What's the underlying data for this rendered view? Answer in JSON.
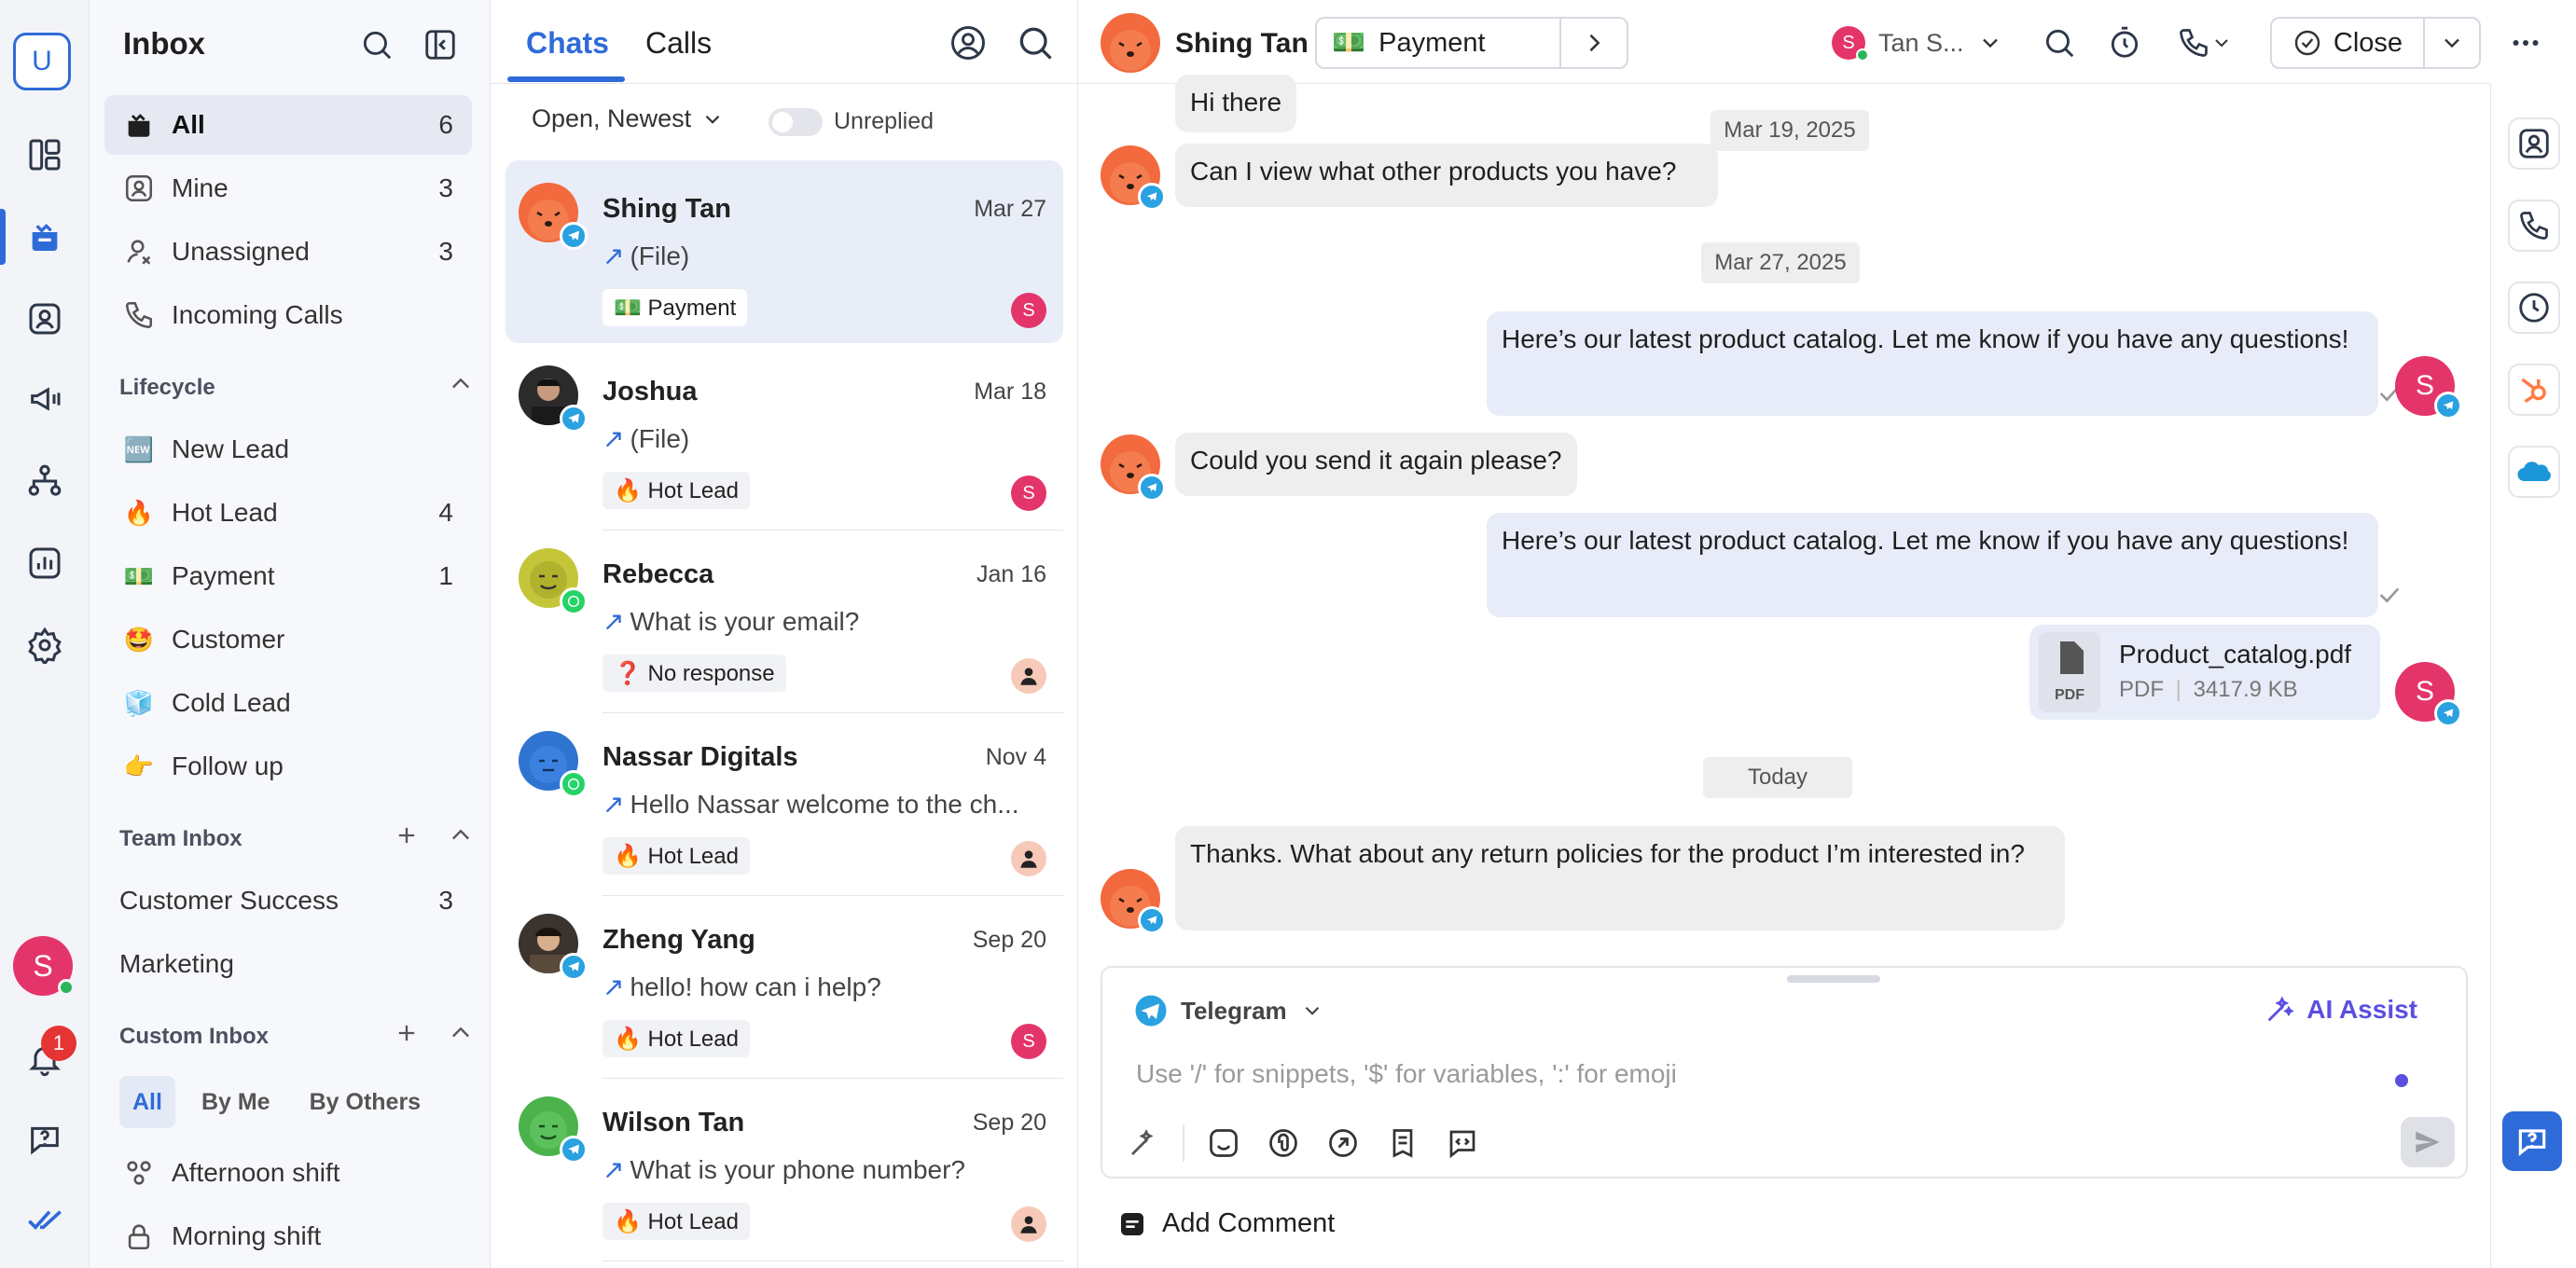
{
  "rail": {
    "logo_letter": "U",
    "user_initial": "S",
    "notifications": "1"
  },
  "inbox": {
    "title": "Inbox",
    "nav": [
      {
        "label": "All",
        "count": "6"
      },
      {
        "label": "Mine",
        "count": "3"
      },
      {
        "label": "Unassigned",
        "count": "3"
      },
      {
        "label": "Incoming Calls",
        "count": ""
      }
    ],
    "lifecycle_heading": "Lifecycle",
    "lifecycle": [
      {
        "emoji": "🆕",
        "label": "New Lead",
        "count": ""
      },
      {
        "emoji": "🔥",
        "label": "Hot Lead",
        "count": "4"
      },
      {
        "emoji": "💵",
        "label": "Payment",
        "count": "1"
      },
      {
        "emoji": "🤩",
        "label": "Customer",
        "count": ""
      },
      {
        "emoji": "🧊",
        "label": "Cold Lead",
        "count": ""
      },
      {
        "emoji": "👉",
        "label": "Follow up",
        "count": ""
      }
    ],
    "team_heading": "Team Inbox",
    "teams": [
      {
        "label": "Customer Success",
        "count": "3"
      },
      {
        "label": "Marketing",
        "count": ""
      }
    ],
    "custom_heading": "Custom Inbox",
    "custom_filters": [
      "All",
      "By Me",
      "By Others"
    ],
    "custom_items": [
      {
        "label": "Afternoon shift"
      },
      {
        "label": "Morning shift"
      }
    ]
  },
  "chats": {
    "tabs": [
      "Chats",
      "Calls"
    ],
    "sort_label": "Open, Newest",
    "toggle_label": "Unreplied",
    "items": [
      {
        "name": "Shing Tan",
        "date": "Mar 27",
        "message": "(File)",
        "tag": "💵 Payment",
        "assignee": "S"
      },
      {
        "name": "Joshua",
        "date": "Mar 18",
        "message": "(File)",
        "tag": "🔥 Hot Lead",
        "assignee": "S"
      },
      {
        "name": "Rebecca",
        "date": "Jan 16",
        "message": "What is your email?",
        "tag": "❓ No response",
        "assignee": ""
      },
      {
        "name": "Nassar Digitals",
        "date": "Nov 4",
        "message": "Hello Nassar welcome to the ch...",
        "tag": "🔥 Hot Lead",
        "assignee": ""
      },
      {
        "name": "Zheng Yang",
        "date": "Sep 20",
        "message": "hello! how can i help?",
        "tag": "🔥 Hot Lead",
        "assignee": "S"
      },
      {
        "name": "Wilson Tan",
        "date": "Sep 20",
        "message": "What is your phone number?",
        "tag": "🔥 Hot Lead",
        "assignee": ""
      }
    ]
  },
  "conversation": {
    "contact_name": "Shing Tan",
    "lifecycle_emoji": "💵",
    "lifecycle_label": "Payment",
    "assignee_initial": "S",
    "assignee_name": "Tan S...",
    "close_label": "Close",
    "messages": {
      "m1": "Hi there",
      "m2": "Can I view what other products you have?",
      "d1": "Mar 19, 2025",
      "d2": "Mar 27, 2025",
      "m3": "Here’s our latest product catalog. Let me know if you have any questions!",
      "m4": "Could you send it again please?",
      "m5": "Here’s our latest product catalog. Let me know if you have any questions!",
      "d3": "Today",
      "m6": "Thanks. What about any return policies for the product I’m interested in?"
    },
    "file": {
      "name": "Product_catalog.pdf",
      "type": "PDF",
      "size": "3417.9 KB",
      "badge": "PDF"
    },
    "composer": {
      "channel": "Telegram",
      "ai_label": "AI Assist",
      "placeholder": "Use '/' for snippets, '$' for variables, ':' for emoji"
    },
    "add_comment": "Add Comment"
  },
  "colors": {
    "accent": "#2f6bd8",
    "user": "#e4356a",
    "telegram": "#2aa1e0",
    "whatsapp": "#25d366",
    "ai": "#5b4fe0"
  }
}
